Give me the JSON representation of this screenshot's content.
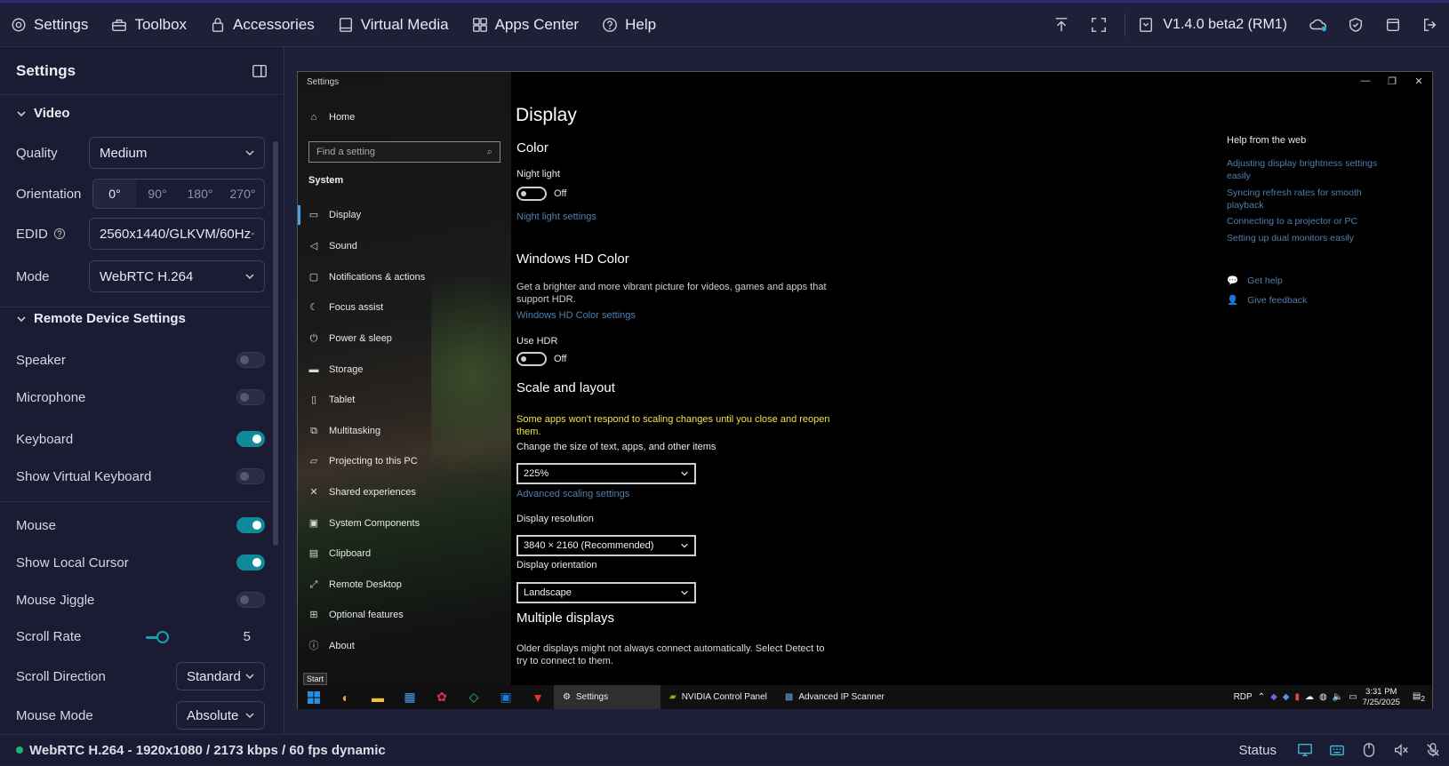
{
  "topbar": {
    "nav": [
      {
        "label": "Settings",
        "icon": "settings-icon"
      },
      {
        "label": "Toolbox",
        "icon": "toolbox-icon"
      },
      {
        "label": "Accessories",
        "icon": "accessories-icon"
      },
      {
        "label": "Virtual Media",
        "icon": "virtual-media-icon"
      },
      {
        "label": "Apps Center",
        "icon": "apps-center-icon"
      },
      {
        "label": "Help",
        "icon": "help-icon"
      }
    ],
    "version": "V1.4.0 beta2 (RM1)"
  },
  "sidebar": {
    "title": "Settings",
    "video": {
      "heading": "Video",
      "quality_label": "Quality",
      "quality_value": "Medium",
      "orientation_label": "Orientation",
      "orientation_options": [
        "0°",
        "90°",
        "180°",
        "270°"
      ],
      "orientation_selected": "0°",
      "edid_label": "EDID",
      "edid_value": "2560x1440/GLKVM/60Hz",
      "mode_label": "Mode",
      "mode_value": "WebRTC H.264"
    },
    "remote": {
      "heading": "Remote Device Settings",
      "speaker": "Speaker",
      "microphone": "Microphone",
      "keyboard": "Keyboard",
      "show_virtual_keyboard": "Show Virtual Keyboard",
      "mouse": "Mouse",
      "show_local_cursor": "Show Local Cursor",
      "mouse_jiggle": "Mouse Jiggle",
      "scroll_rate_label": "Scroll Rate",
      "scroll_rate_value": "5",
      "scroll_direction_label": "Scroll Direction",
      "scroll_direction_value": "Standard",
      "mouse_mode_label": "Mouse Mode",
      "mouse_mode_value": "Absolute"
    },
    "toggles": {
      "speaker": false,
      "microphone": false,
      "keyboard": true,
      "show_virtual_keyboard": false,
      "mouse": true,
      "show_local_cursor": true,
      "mouse_jiggle": false
    }
  },
  "statusbar": {
    "stream": "WebRTC H.264 - 1920x1080 / 2173 kbps / 60 fps dynamic",
    "status_label": "Status"
  },
  "remote_screen": {
    "window_title": "Settings",
    "pane": {
      "home": "Home",
      "search_placeholder": "Find a setting",
      "section": "System",
      "items": [
        "Display",
        "Sound",
        "Notifications & actions",
        "Focus assist",
        "Power & sleep",
        "Storage",
        "Tablet",
        "Multitasking",
        "Projecting to this PC",
        "Shared experiences",
        "System Components",
        "Clipboard",
        "Remote Desktop",
        "Optional features",
        "About"
      ]
    },
    "content": {
      "title": "Display",
      "color_heading": "Color",
      "night_light_label": "Night light",
      "night_light_state": "Off",
      "night_light_settings": "Night light settings",
      "hd_heading": "Windows HD Color",
      "hd_desc_1": "Get a brighter and more vibrant picture for videos, games and apps that",
      "hd_desc_2": "support HDR.",
      "hd_settings": "Windows HD Color settings",
      "use_hdr_label": "Use HDR",
      "use_hdr_state": "Off",
      "scale_heading": "Scale and layout",
      "scale_warning_1": "Some apps won't respond to scaling changes until you close and reopen",
      "scale_warning_2": "them.",
      "scale_label": "Change the size of text, apps, and other items",
      "scale_value": "225%",
      "adv_scaling": "Advanced scaling settings",
      "resolution_label": "Display resolution",
      "resolution_value": "3840 × 2160 (Recommended)",
      "orientation_label": "Display orientation",
      "orientation_value": "Landscape",
      "multi_heading": "Multiple displays",
      "multi_desc": "Older displays might not always connect automatically. Select Detect to",
      "multi_desc_2": "try to connect to them."
    },
    "help": {
      "heading": "Help from the web",
      "links": [
        "Adjusting display brightness settings easily",
        "Syncing refresh rates for smooth playback",
        "Connecting to a projector or PC",
        "Setting up dual monitors easily"
      ],
      "get_help": "Get help",
      "give_feedback": "Give feedback"
    },
    "taskbar": {
      "start_tooltip": "Start",
      "apps": [
        "Settings",
        "NVIDIA Control Panel",
        "Advanced IP Scanner"
      ],
      "tray_label": "RDP",
      "time": "3:31 PM",
      "date": "7/25/2025",
      "notif_count": "2"
    }
  }
}
